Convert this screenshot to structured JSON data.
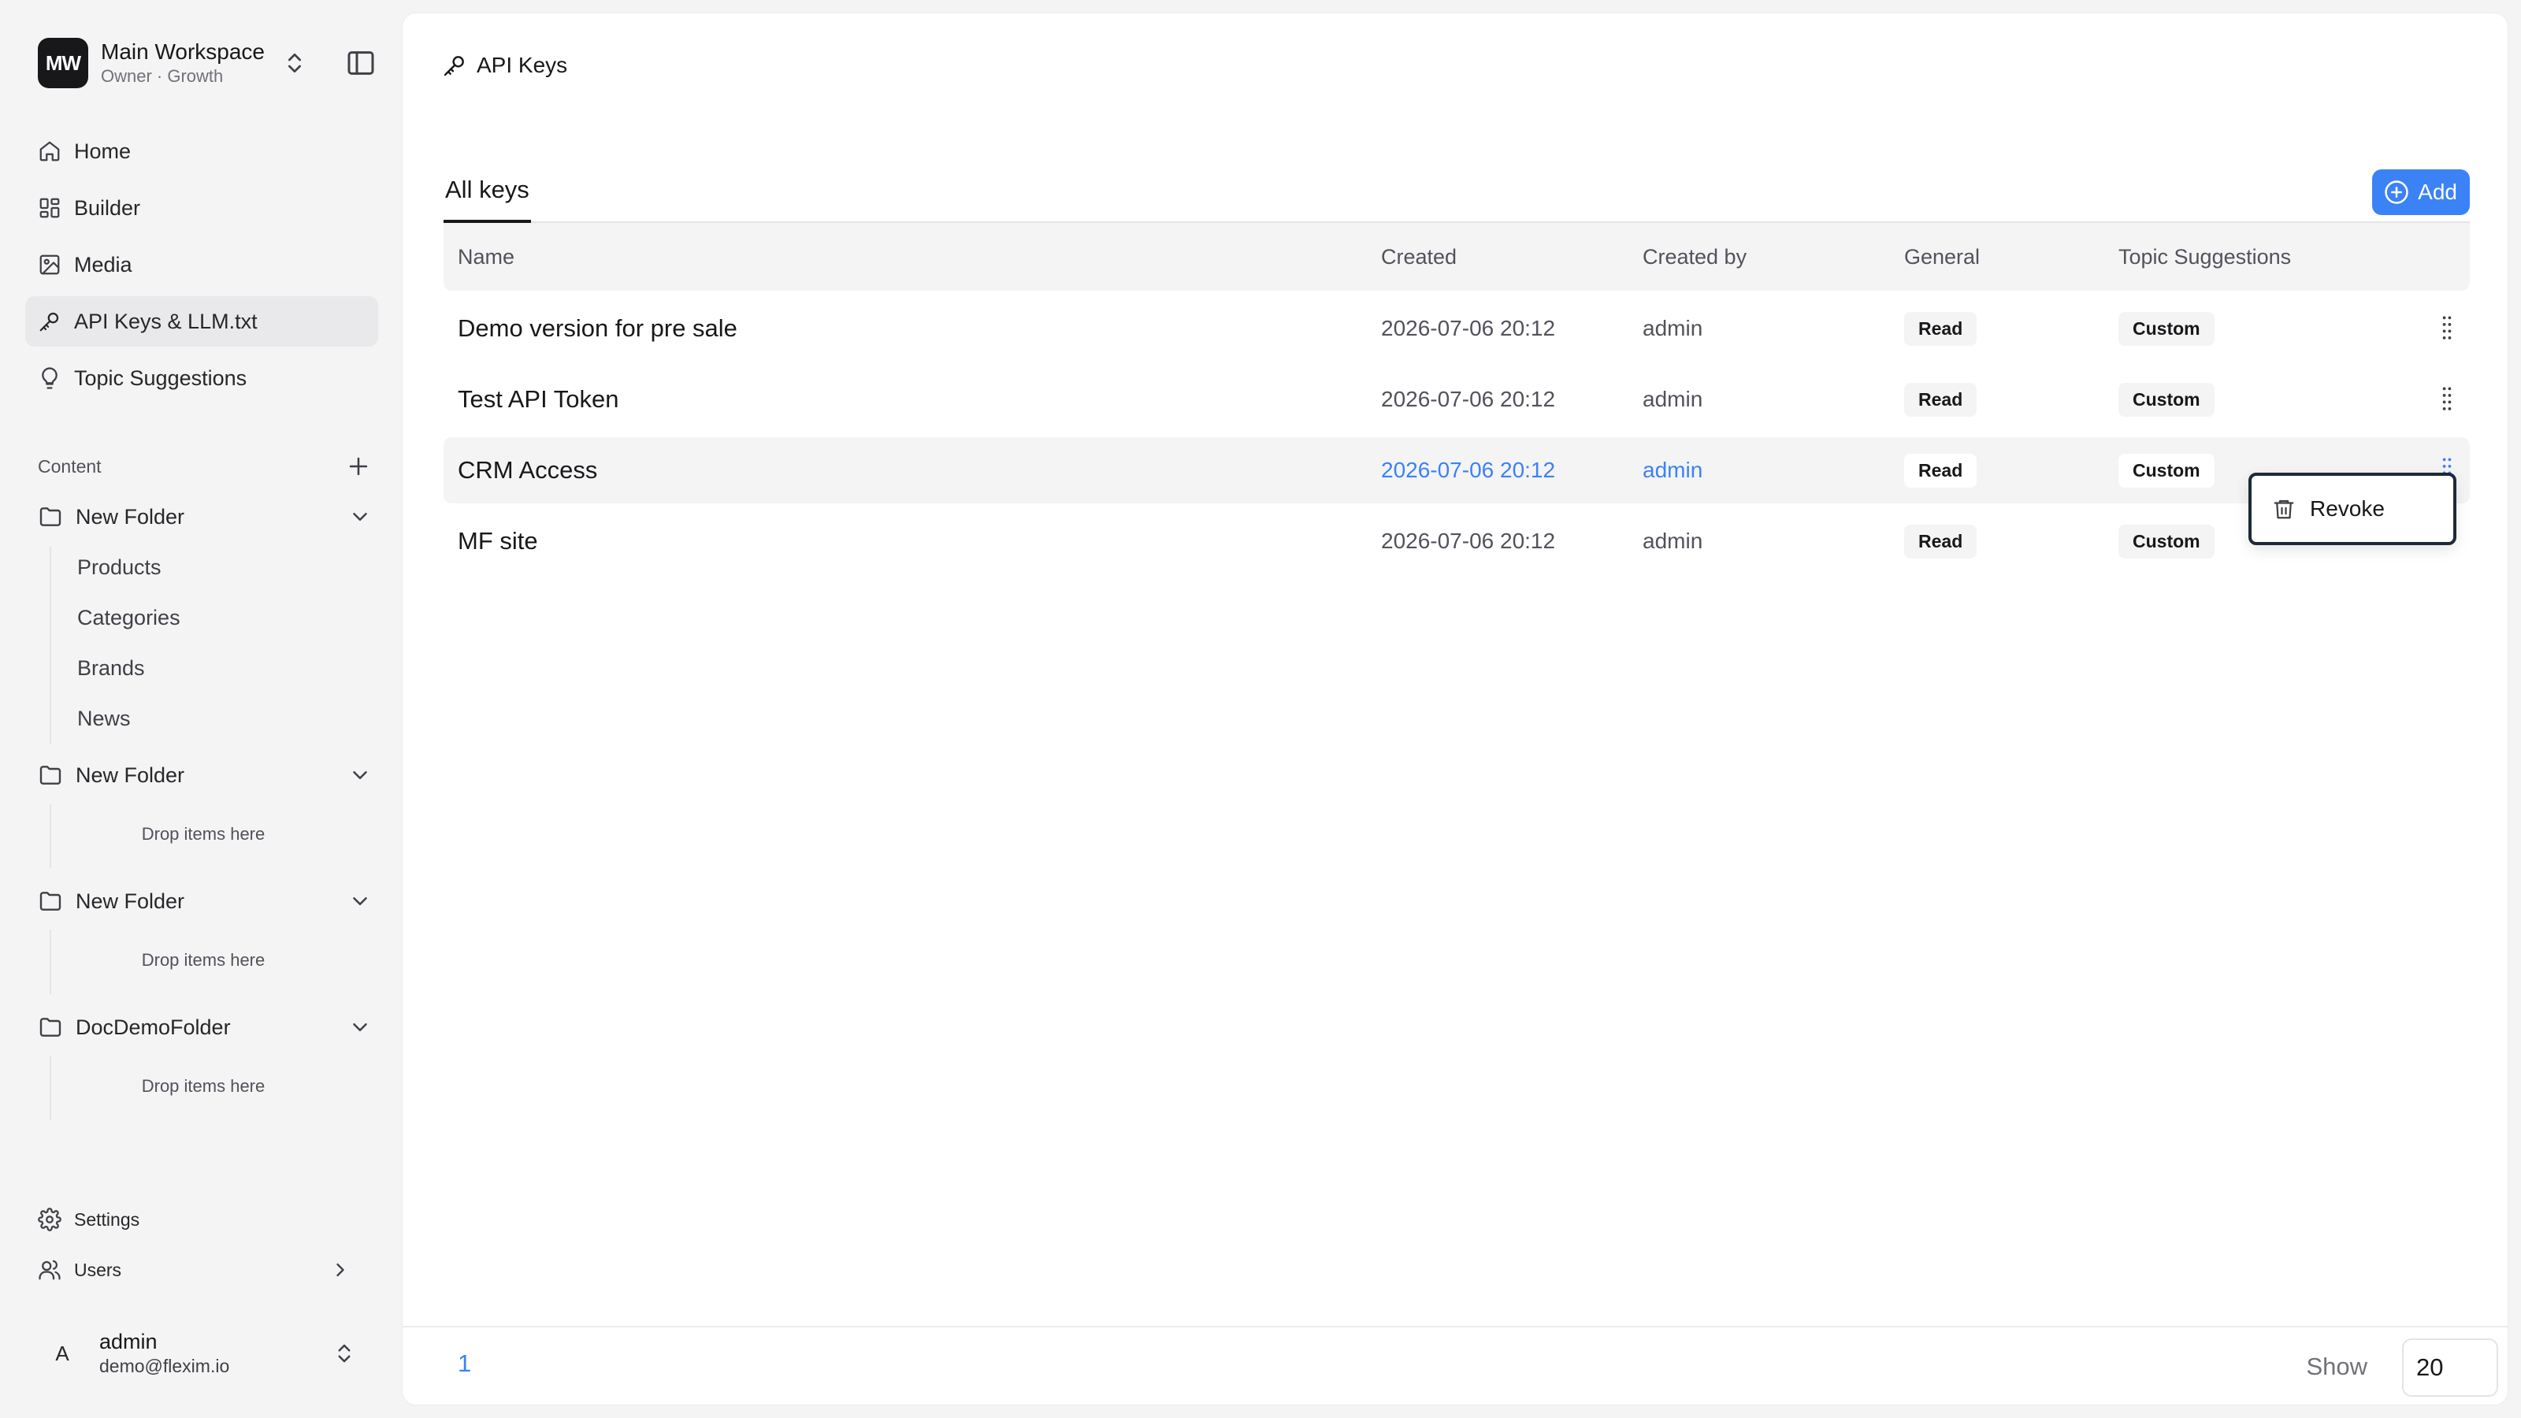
{
  "workspace": {
    "initials": "MW",
    "name": "Main Workspace",
    "subtitle": "Owner · Growth"
  },
  "nav": [
    {
      "label": "Home",
      "icon": "home-icon"
    },
    {
      "label": "Builder",
      "icon": "grid-icon"
    },
    {
      "label": "Media",
      "icon": "image-icon"
    },
    {
      "label": "API Keys & LLM.txt",
      "icon": "key-icon",
      "active": true
    },
    {
      "label": "Topic Suggestions",
      "icon": "lightbulb-icon"
    }
  ],
  "content": {
    "label": "Content",
    "folders": [
      {
        "name": "New Folder",
        "children": [
          "Products",
          "Categories",
          "Brands",
          "News"
        ]
      },
      {
        "name": "New Folder",
        "drop": "Drop items here"
      },
      {
        "name": "New Folder",
        "drop": "Drop items here"
      },
      {
        "name": "DocDemoFolder",
        "drop": "Drop items here"
      }
    ]
  },
  "bottom_nav": {
    "settings": "Settings",
    "users": "Users"
  },
  "user": {
    "initial": "A",
    "name": "admin",
    "email": "demo@flexim.io"
  },
  "page": {
    "breadcrumb": "API Keys",
    "tab": "All keys",
    "add_label": "Add"
  },
  "table": {
    "headers": {
      "name": "Name",
      "created": "Created",
      "created_by": "Created by",
      "general": "General",
      "topic": "Topic Suggestions"
    },
    "rows": [
      {
        "name": "Demo version for pre sale",
        "created": "2026-07-06 20:12",
        "created_by": "admin",
        "general": "Read",
        "topic": "Custom"
      },
      {
        "name": "Test API Token",
        "created": "2026-07-06 20:12",
        "created_by": "admin",
        "general": "Read",
        "topic": "Custom"
      },
      {
        "name": "CRM Access",
        "created": "2026-07-06 20:12",
        "created_by": "admin",
        "general": "Read",
        "topic": "Custom"
      },
      {
        "name": "MF site",
        "created": "2026-07-06 20:12",
        "created_by": "admin",
        "general": "Read",
        "topic": "Custom"
      }
    ]
  },
  "context_menu": {
    "revoke": "Revoke"
  },
  "pagination": {
    "page": "1",
    "show_label": "Show",
    "page_size": "20"
  },
  "colors": {
    "accent": "#3b82f6",
    "dark": "#18181b",
    "menu_border": "#1f2937"
  }
}
